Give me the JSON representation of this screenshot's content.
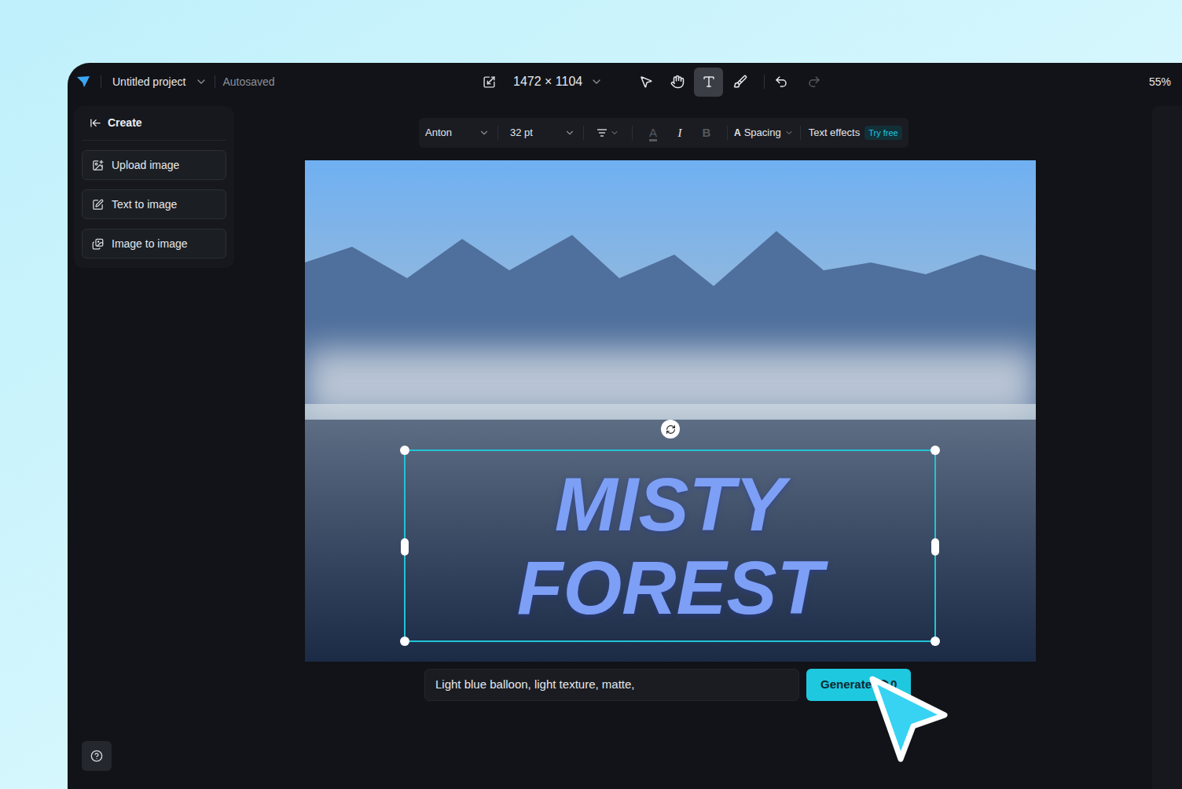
{
  "window": {
    "title": "Untitled project",
    "status": "Autosaved",
    "zoom": "55%"
  },
  "canvas_size": "1472 × 1104",
  "tools": [
    {
      "selected": false
    },
    {
      "selected": false
    },
    {
      "selected": true
    },
    {
      "selected": false
    }
  ],
  "history": {
    "undo_disabled": false,
    "redo_disabled": true
  },
  "sidebar": {
    "heading": "Create",
    "items": [
      {
        "label": "Upload image"
      },
      {
        "label": "Text to image"
      },
      {
        "label": "Image to image"
      }
    ]
  },
  "text_toolbar": {
    "font": "Anton",
    "size": "32 pt",
    "format": [
      {
        "label": "A",
        "kind": "color",
        "disabled": true
      },
      {
        "label": "I",
        "kind": "italic",
        "disabled": false
      },
      {
        "label": "B",
        "kind": "bold",
        "disabled": true
      }
    ],
    "spacing": "Spacing",
    "effects": "Text effects",
    "effects_badge": "Try free"
  },
  "canvas": {
    "text_lines": [
      "MISTY",
      "FOREST"
    ],
    "selected": true
  },
  "prompt": {
    "value": "Light blue balloon, light texture, matte,"
  },
  "generate": {
    "label": "Generate",
    "credits": "0"
  }
}
